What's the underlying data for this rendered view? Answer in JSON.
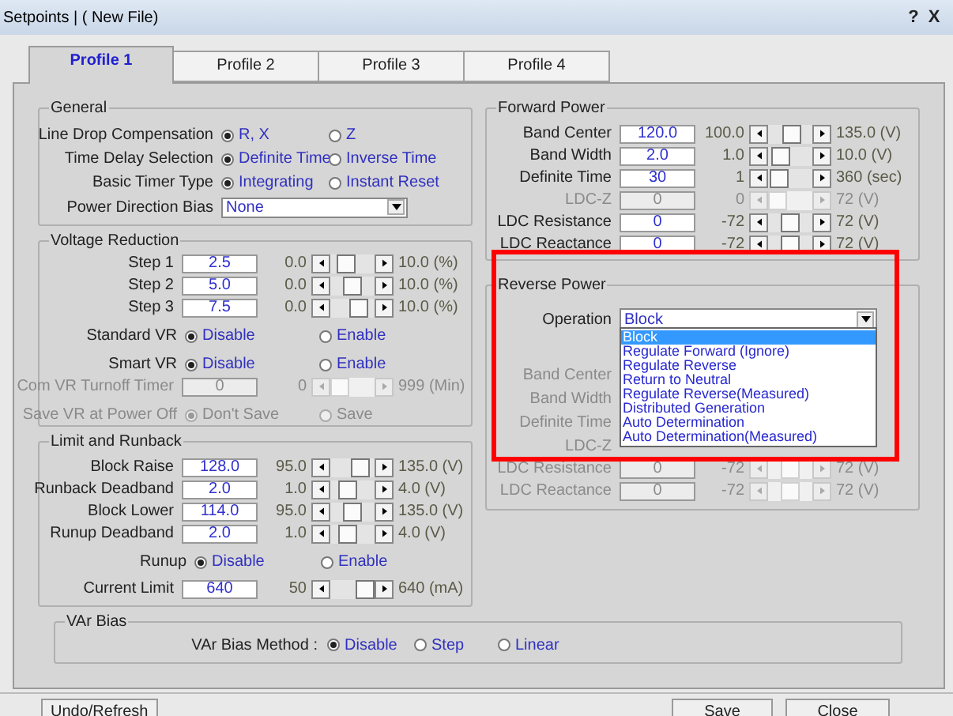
{
  "window": {
    "title": "Setpoints | ( New File)",
    "help_button": "?",
    "close_button": "X"
  },
  "tabs": [
    {
      "label": "Profile 1",
      "selected": true
    },
    {
      "label": "Profile 2",
      "selected": false
    },
    {
      "label": "Profile 3",
      "selected": false
    },
    {
      "label": "Profile 4",
      "selected": false
    }
  ],
  "general": {
    "title": "General",
    "rows": [
      {
        "kind": "radio",
        "label": "Line Drop Compensation",
        "disabled": false,
        "options": [
          {
            "label": "R, X",
            "selected": true
          },
          {
            "label": "Z",
            "selected": false
          }
        ]
      },
      {
        "kind": "radio",
        "label": "Time Delay Selection",
        "disabled": false,
        "options": [
          {
            "label": "Definite Time",
            "selected": true
          },
          {
            "label": "Inverse Time",
            "selected": false
          }
        ]
      },
      {
        "kind": "radio",
        "label": "Basic Timer Type",
        "disabled": false,
        "options": [
          {
            "label": "Integrating",
            "selected": true
          },
          {
            "label": "Instant Reset",
            "selected": false
          }
        ]
      },
      {
        "kind": "select",
        "label": "Power Direction Bias",
        "value": "None"
      }
    ]
  },
  "voltage_reduction": {
    "title": "Voltage Reduction",
    "rows": [
      {
        "kind": "spin",
        "label": "Step 1",
        "value": "2.5",
        "min": "0.0",
        "max": "10.0 (%)",
        "level": 0.25,
        "disabled": false
      },
      {
        "kind": "spin",
        "label": "Step 2",
        "value": "5.0",
        "min": "0.0",
        "max": "10.0 (%)",
        "level": 0.5,
        "disabled": false
      },
      {
        "kind": "spin",
        "label": "Step 3",
        "value": "7.5",
        "min": "0.0",
        "max": "10.0 (%)",
        "level": 0.75,
        "disabled": false
      },
      {
        "kind": "radio",
        "label": "Standard VR",
        "disabled": false,
        "options": [
          {
            "label": "Disable",
            "selected": true
          },
          {
            "label": "Enable",
            "selected": false
          }
        ]
      },
      {
        "kind": "radio",
        "label": "Smart VR",
        "disabled": false,
        "options": [
          {
            "label": "Disable",
            "selected": true
          },
          {
            "label": "Enable",
            "selected": false
          }
        ]
      },
      {
        "kind": "spin",
        "label": "Com VR Turnoff Timer",
        "value": "0",
        "min": "0",
        "max": "999 (Min)",
        "level": 0,
        "disabled": true
      },
      {
        "kind": "radio",
        "label": "Save VR at Power Off",
        "disabled": true,
        "options": [
          {
            "label": "Don't Save",
            "selected": true
          },
          {
            "label": "Save",
            "selected": false
          }
        ]
      }
    ]
  },
  "limit_and_runback": {
    "title": "Limit and Runback",
    "rows": [
      {
        "kind": "spin",
        "label": "Block Raise",
        "value": "128.0",
        "min": "95.0",
        "max": "135.0 (V)",
        "level": 0.82,
        "disabled": false
      },
      {
        "kind": "spin",
        "label": "Runback Deadband",
        "value": "2.0",
        "min": "1.0",
        "max": "4.0 (V)",
        "level": 0.33,
        "disabled": false
      },
      {
        "kind": "spin",
        "label": "Block Lower",
        "value": "114.0",
        "min": "95.0",
        "max": "135.0 (V)",
        "level": 0.48,
        "disabled": false
      },
      {
        "kind": "spin",
        "label": "Runup Deadband",
        "value": "2.0",
        "min": "1.0",
        "max": "4.0 (V)",
        "level": 0.33,
        "disabled": false
      },
      {
        "kind": "radio",
        "label": "Runup",
        "disabled": false,
        "options": [
          {
            "label": "Disable",
            "selected": true
          },
          {
            "label": "Enable",
            "selected": false
          }
        ]
      },
      {
        "kind": "spin",
        "label": "Current Limit",
        "value": "640",
        "min": "50",
        "max": "640 (mA)",
        "level": 1,
        "disabled": false
      }
    ]
  },
  "forward_power": {
    "title": "Forward Power",
    "rows": [
      {
        "kind": "spin",
        "label": "Band Center",
        "value": "120.0",
        "min": "100.0",
        "max": "135.0 (V)",
        "level": 0.57,
        "disabled": false
      },
      {
        "kind": "spin",
        "label": "Band Width",
        "value": "2.0",
        "min": "1.0",
        "max": "10.0 (V)",
        "level": 0.11,
        "disabled": false
      },
      {
        "kind": "spin",
        "label": "Definite Time",
        "value": "30",
        "min": "1",
        "max": "360 (sec)",
        "level": 0.08,
        "disabled": false
      },
      {
        "kind": "spin",
        "label": "LDC-Z",
        "value": "0",
        "min": "0",
        "max": "72 (V)",
        "level": 0,
        "disabled": true
      },
      {
        "kind": "spin",
        "label": "LDC Resistance",
        "value": "0",
        "min": "-72",
        "max": "72 (V)",
        "level": 0.5,
        "disabled": false
      },
      {
        "kind": "spin",
        "label": "LDC Reactance",
        "value": "0",
        "min": "-72",
        "max": "72 (V)",
        "level": 0.5,
        "disabled": false
      }
    ]
  },
  "reverse_power": {
    "title": "Reverse Power",
    "highlighted": true,
    "operation": {
      "label": "Operation",
      "value": "Block",
      "expanded": true,
      "options": [
        {
          "label": "Block",
          "selected": true
        },
        {
          "label": "Regulate Forward (Ignore)",
          "selected": false
        },
        {
          "label": "Regulate Reverse",
          "selected": false
        },
        {
          "label": "Return to Neutral",
          "selected": false
        },
        {
          "label": "Regulate Reverse(Measured)",
          "selected": false
        },
        {
          "label": "Distributed Generation",
          "selected": false
        },
        {
          "label": "Auto Determination",
          "selected": false
        },
        {
          "label": "Auto Determination(Measured)",
          "selected": false
        }
      ]
    },
    "rows": [
      {
        "kind": "hidden",
        "label": "Band Center"
      },
      {
        "kind": "hidden",
        "label": "Band Width"
      },
      {
        "kind": "hidden",
        "label": "Definite Time"
      },
      {
        "kind": "hidden",
        "label": "LDC-Z"
      },
      {
        "kind": "spin",
        "label": "LDC Resistance",
        "value": "0",
        "min": "-72",
        "max": "72 (V)",
        "level": 0.5,
        "disabled": true
      },
      {
        "kind": "spin",
        "label": "LDC Reactance",
        "value": "0",
        "min": "-72",
        "max": "72 (V)",
        "level": 0.5,
        "disabled": true
      }
    ]
  },
  "var_bias": {
    "title": "VAr Bias",
    "label": "VAr Bias Method :",
    "options": [
      {
        "label": "Disable",
        "selected": true
      },
      {
        "label": "Step",
        "selected": false
      },
      {
        "label": "Linear",
        "selected": false
      }
    ]
  },
  "buttons": [
    {
      "label": "Undo/Refresh"
    },
    {
      "label": "Save"
    },
    {
      "label": "Close"
    }
  ]
}
